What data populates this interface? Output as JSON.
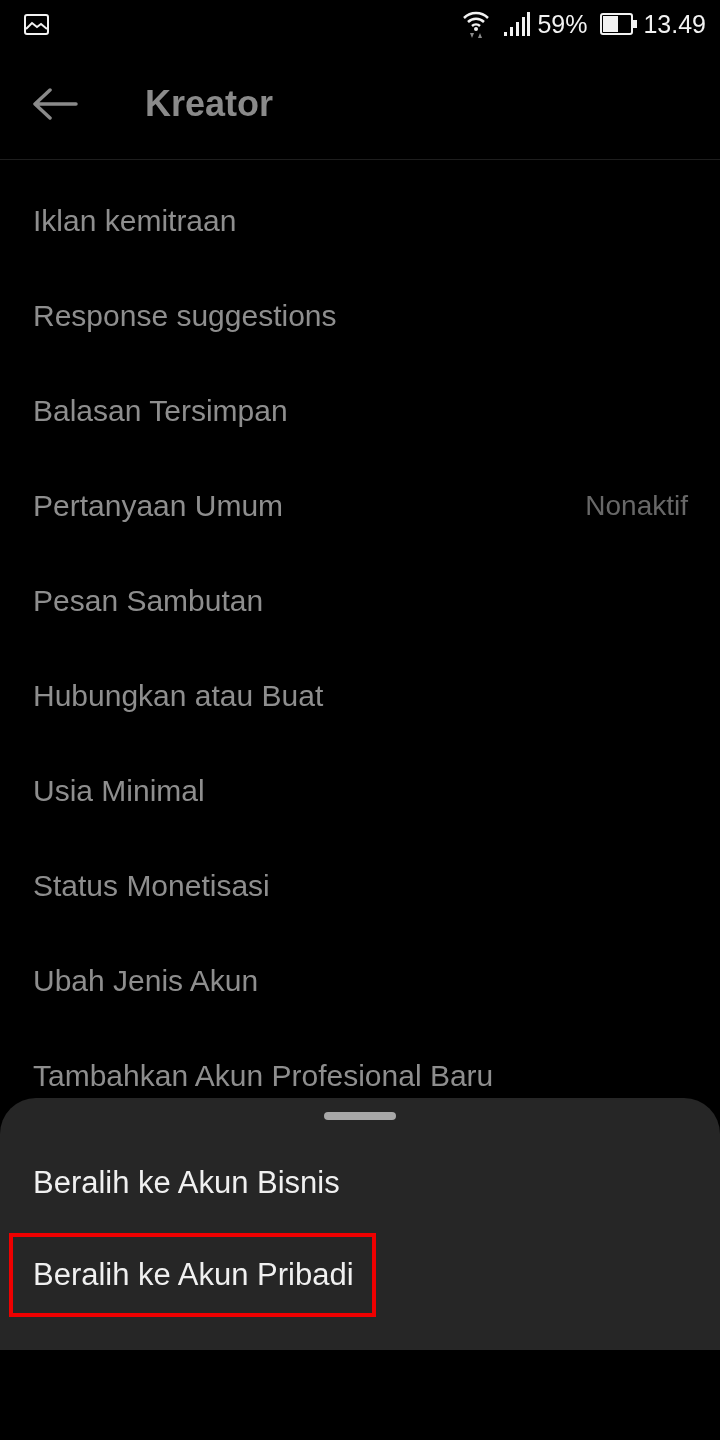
{
  "status_bar": {
    "battery_text": "59%",
    "time": "13.49"
  },
  "header": {
    "title": "Kreator"
  },
  "menu": {
    "items": [
      {
        "label": "Iklan kemitraan"
      },
      {
        "label": "Response suggestions"
      },
      {
        "label": "Balasan Tersimpan"
      },
      {
        "label": "Pertanyaan Umum",
        "value": "Nonaktif"
      },
      {
        "label": "Pesan Sambutan"
      },
      {
        "label": "Hubungkan atau Buat"
      },
      {
        "label": "Usia Minimal"
      },
      {
        "label": "Status Monetisasi"
      },
      {
        "label": "Ubah Jenis Akun"
      },
      {
        "label": "Tambahkan Akun Profesional Baru"
      }
    ]
  },
  "bottom_sheet": {
    "options": [
      {
        "label": "Beralih ke Akun Bisnis",
        "highlighted": false
      },
      {
        "label": "Beralih ke Akun Pribadi",
        "highlighted": true
      }
    ]
  }
}
